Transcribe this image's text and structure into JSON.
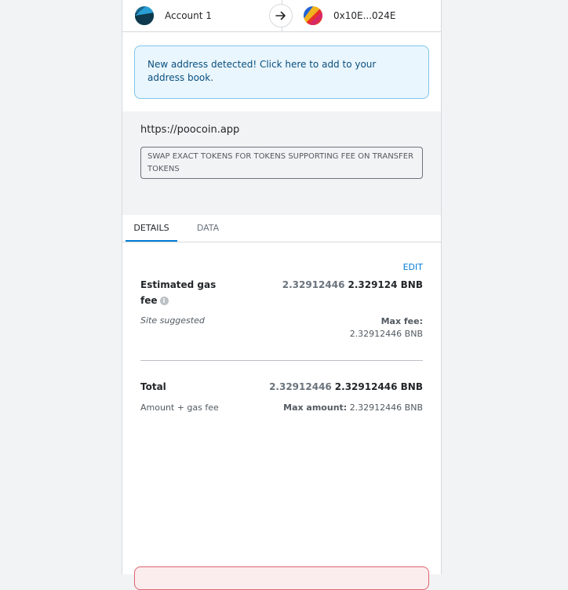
{
  "accounts": {
    "from_name": "Account 1",
    "to_address": "0x10E...024E"
  },
  "notice": {
    "text": "New address detected! Click here to add to your address book."
  },
  "origin": {
    "url": "https://poocoin.app",
    "method": "SWAP EXACT TOKENS FOR TOKENS SUPPORTING FEE ON TRANSFER TOKENS"
  },
  "tabs": [
    {
      "label": "DETAILS",
      "active": true
    },
    {
      "label": "DATA",
      "active": false
    }
  ],
  "details": {
    "edit_label": "EDIT",
    "gas": {
      "label_line1": "Estimated gas",
      "label_line2": "fee",
      "value_muted": "2.32912446",
      "value_main": "2.329124 BNB",
      "sub": "Site suggested",
      "max_fee_label": "Max fee:",
      "max_fee_value": "2.32912446 BNB"
    },
    "total": {
      "label": "Total",
      "value_muted": "2.32912446",
      "value_main": "2.32912446 BNB",
      "sub": "Amount + gas fee",
      "max_amount_label": "Max amount:",
      "max_amount_value": "2.32912446 BNB"
    }
  },
  "colors": {
    "accent": "#037dd6",
    "notice_bg": "#eaf6fd",
    "error_border": "#e06470"
  },
  "icons": [
    "account-avatar-icon",
    "arrow-right-icon",
    "recipient-avatar-icon",
    "info-icon"
  ]
}
